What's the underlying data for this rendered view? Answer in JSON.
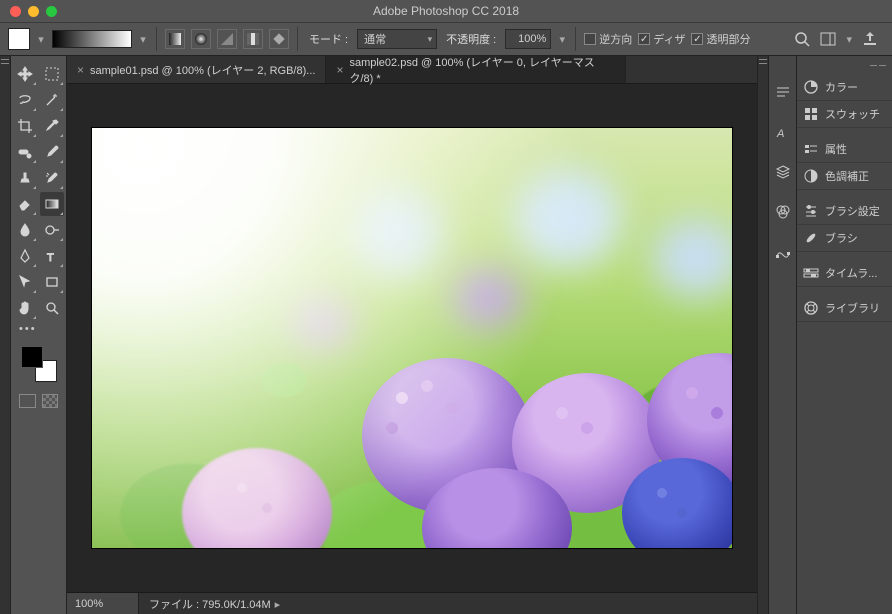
{
  "app": {
    "title": "Adobe Photoshop CC 2018"
  },
  "options_bar": {
    "mode_label": "モード :",
    "blend_mode": "通常",
    "opacity_label": "不透明度 :",
    "opacity_value": "100%",
    "reverse": {
      "label": "逆方向",
      "checked": false
    },
    "dither": {
      "label": "ディザ",
      "checked": true
    },
    "transparency": {
      "label": "透明部分",
      "checked": true
    }
  },
  "tabs": [
    {
      "label": "sample01.psd @ 100% (レイヤー 2, RGB/8)...",
      "active": false
    },
    {
      "label": "sample02.psd @ 100% (レイヤー 0, レイヤーマスク/8) *",
      "active": true
    }
  ],
  "status": {
    "zoom": "100%",
    "info": "ファイル : 795.0K/1.04M"
  },
  "panels": {
    "group1": [
      {
        "icon": "color",
        "label": "カラー"
      },
      {
        "icon": "swatches",
        "label": "スウォッチ"
      }
    ],
    "group2": [
      {
        "icon": "properties",
        "label": "属性"
      },
      {
        "icon": "adjustments",
        "label": "色調補正"
      }
    ],
    "group3": [
      {
        "icon": "brush-settings",
        "label": "ブラシ設定"
      },
      {
        "icon": "brushes",
        "label": "ブラシ"
      }
    ],
    "group4": [
      {
        "icon": "timeline",
        "label": "タイムラ..."
      }
    ],
    "group5": [
      {
        "icon": "libraries",
        "label": "ライブラリ"
      }
    ]
  },
  "tools": [
    "move",
    "marquee",
    "lasso",
    "magic-wand",
    "crop",
    "eyedropper",
    "spot-heal",
    "brush",
    "clone-stamp",
    "history-brush",
    "eraser",
    "gradient",
    "blur",
    "dodge",
    "pen",
    "type",
    "path-select",
    "rectangle",
    "hand",
    "zoom"
  ],
  "active_tool": "gradient"
}
